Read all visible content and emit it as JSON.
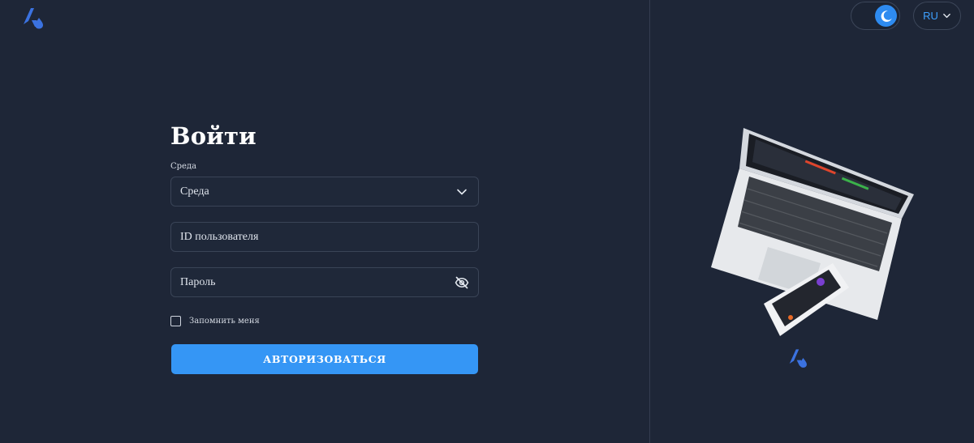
{
  "header": {
    "logo_icon": "brand-logo-icon",
    "theme": "dark",
    "theme_icon": "moon-icon",
    "language": "RU",
    "language_icon": "chevron-down-icon"
  },
  "login": {
    "title": "Войти",
    "environment_label": "Среда",
    "environment_value": "Среда",
    "environment_icon": "chevron-down-icon",
    "user_id_placeholder": "ID пользователя",
    "password_placeholder": "Пароль",
    "password_icon": "eye-off-icon",
    "remember_label": "Запомнить меня",
    "remember_checked": false,
    "submit_label": "АВТОРИЗОВАТЬСЯ"
  },
  "colors": {
    "background": "#1e2637",
    "accent": "#3596f5",
    "logo": "#3b72e0"
  }
}
